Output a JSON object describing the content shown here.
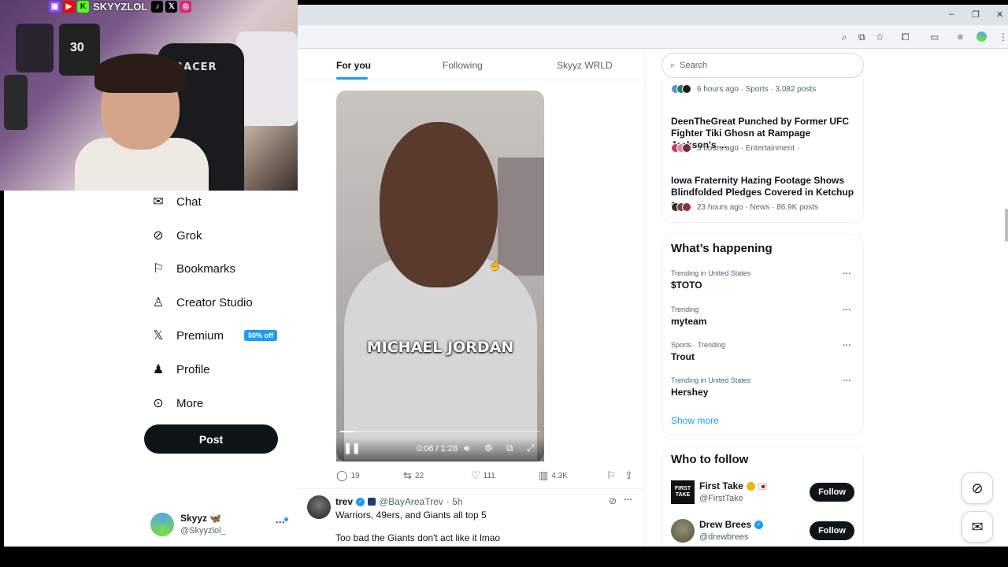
{
  "stream": {
    "channel_name": "SKYYZLOL",
    "chair_brand": "RACER",
    "jersey_number": "30"
  },
  "browser": {
    "win_min": "–",
    "win_restore": "❐",
    "win_close": "✕"
  },
  "nav": {
    "items": [
      {
        "label": "Chat",
        "icon": "mail-icon"
      },
      {
        "label": "Grok",
        "icon": "grok-icon"
      },
      {
        "label": "Bookmarks",
        "icon": "bookmark-icon"
      },
      {
        "label": "Creator Studio",
        "icon": "creator-studio-icon"
      },
      {
        "label": "Premium",
        "icon": "x-icon"
      },
      {
        "label": "Profile",
        "icon": "profile-icon"
      },
      {
        "label": "More",
        "icon": "more-icon"
      }
    ],
    "premium_badge": "50% off",
    "post_label": "Post"
  },
  "account": {
    "name": "Skyyz 🦋",
    "handle": "@Skyyzlol_",
    "more": "···"
  },
  "tabs": [
    {
      "label": "For you",
      "active": true
    },
    {
      "label": "Following",
      "active": false
    },
    {
      "label": "Skyyz WRLD",
      "active": false
    }
  ],
  "tweet": {
    "video_caption": "MICHAEL JORDAN",
    "video_time": "0:06 / 1:28",
    "progress": 0.07,
    "replies": "19",
    "reposts": "22",
    "likes": "111",
    "views": "4.3K"
  },
  "next_tweet": {
    "name": "trev",
    "handle": "@BayAreaTrev",
    "time": "· 5h",
    "line1": "Warriors, 49ers, and Giants all top 5",
    "line2": "Too bad the Giants don't act like it lmao",
    "more": "···"
  },
  "search": {
    "placeholder": "Search"
  },
  "news": [
    {
      "title": "",
      "meta": "6 hours ago · Sports · 3,082 posts"
    },
    {
      "title": "DeenTheGreat Punched by Former UFC Fighter Tiki Ghosn at Rampage Jackson's ...",
      "meta": "3 hours ago · Entertainment ·"
    },
    {
      "title": "Iowa Fraternity Hazing Footage Shows Blindfolded Pledges Covered in Ketchup a...",
      "meta": "23 hours ago · News · 86.9K posts"
    }
  ],
  "happening": {
    "title": "What’s happening",
    "trends": [
      {
        "context": "Trending in United States",
        "name": "$TOTO"
      },
      {
        "context": "Trending",
        "name": "myteam"
      },
      {
        "context": "Sports · Trending",
        "name": "Trout"
      },
      {
        "context": "Trending in United States",
        "name": "Hershey"
      }
    ],
    "show_more": "Show more",
    "dots": "···"
  },
  "who_to_follow": {
    "title": "Who to follow",
    "accounts": [
      {
        "name": "First Take",
        "handle": "@FirstTake",
        "follow": "Follow",
        "avatar_text": "FIRST TAKE"
      },
      {
        "name": "Drew Brees",
        "handle": "@drewbrees",
        "follow": "Follow"
      }
    ]
  },
  "colors": {
    "accent": "#1d9bf0",
    "dark": "#0f1419",
    "muted": "#536471"
  }
}
